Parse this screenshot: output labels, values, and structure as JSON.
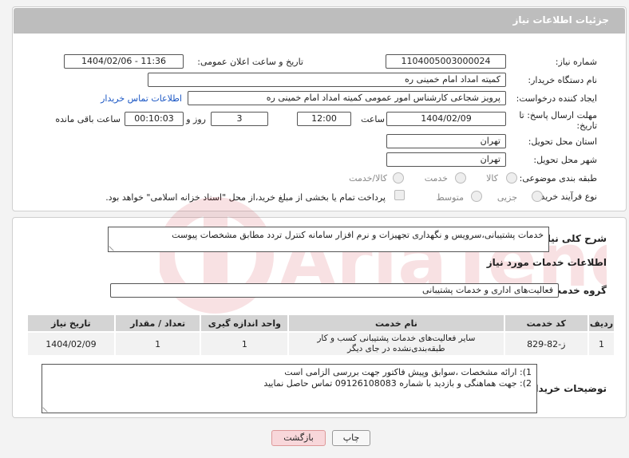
{
  "header": {
    "title": "جزئیات اطلاعات نیاز"
  },
  "form": {
    "need_number_label": "شماره نیاز:",
    "need_number": "1104005003000024",
    "announce_label": "تاریخ و ساعت اعلان عمومی:",
    "announce_value": "1404/02/06 - 11:36",
    "buyer_org_label": "نام دستگاه خریدار:",
    "buyer_org": "کمیته امداد امام خمینی ره",
    "requester_label": "ایجاد کننده درخواست:",
    "requester": "پرویز شجاعی کارشناس امور عمومی کمیته امداد امام خمینی ره",
    "buyer_contact_link": "اطلاعات تماس خریدار",
    "deadline_label": "مهلت ارسال پاسخ: تا تاریخ:",
    "deadline_date": "1404/02/09",
    "time_label": "ساعت",
    "deadline_time": "12:00",
    "days_value": "3",
    "days_label": "روز و",
    "remaining_time": "00:10:03",
    "remaining_label": "ساعت باقی مانده",
    "province_label": "استان محل تحویل:",
    "province": "تهران",
    "city_label": "شهر محل تحویل:",
    "city": "تهران",
    "category_label": "طبقه بندی موضوعی:",
    "category_options": [
      "کالا",
      "خدمت",
      "کالا/خدمت"
    ],
    "process_label": "نوع فرآیند خرید :",
    "process_options": [
      "جزیی",
      "متوسط"
    ],
    "payment_note": "پرداخت تمام یا بخشی از مبلغ خرید،از محل \"اسناد خزانه اسلامی\" خواهد بود."
  },
  "details": {
    "summary_label": "شرح کلی نیاز:",
    "summary_text": "خدمات پشتیبانی،سرویس و نگهداری تجهیزات و نرم افزار سامانه کنترل تردد مطابق مشخصات پیوست",
    "services_heading": "اطلاعات خدمات مورد نیاز",
    "service_group_label": "گروه خدمت:",
    "service_group": "فعالیت‌های اداری و خدمات پشتیبانی",
    "table": {
      "headers": [
        "ردیف",
        "کد خدمت",
        "نام خدمت",
        "واحد اندازه گیری",
        "تعداد / مقدار",
        "تاریخ نیاز"
      ],
      "rows": [
        [
          "1",
          "ز-82-829",
          "سایر فعالیت‌های خدمات پشتیبانی کسب و کار طبقه‌بندی‌نشده در جای دیگر",
          "1",
          "1",
          "1404/02/09"
        ]
      ]
    },
    "buyer_notes_label": "توضیحات خریدار:",
    "buyer_notes": [
      "1): ارائه مشخصات ،سوابق وپیش فاکتور جهت بررسی الزامی است",
      "2): جهت هماهنگی و بازدید با شماره 09126108083 تماس حاصل نمایید"
    ]
  },
  "buttons": {
    "print": "چاپ",
    "back": "بازگشت"
  },
  "colors": {
    "header_bg": "#bdbdbd",
    "link": "#1a56c4",
    "back_button": "#f8d7da"
  }
}
